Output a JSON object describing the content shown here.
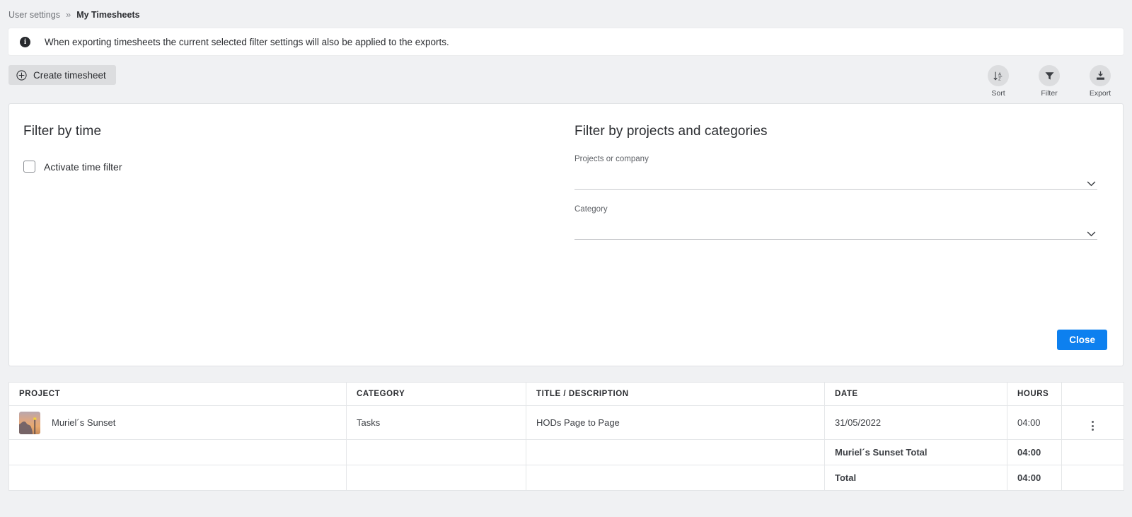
{
  "breadcrumb": {
    "parent": "User settings",
    "separator": "»",
    "current": "My Timesheets"
  },
  "banner": {
    "icon": "info-icon",
    "text": "When exporting timesheets the current selected filter settings will also be applied to the exports."
  },
  "actions": {
    "create_label": "Create timesheet",
    "create_icon": "plus-circle-icon",
    "tools": [
      {
        "label": "Sort",
        "icon": "sort-az-icon"
      },
      {
        "label": "Filter",
        "icon": "funnel-icon"
      },
      {
        "label": "Export",
        "icon": "download-tray-icon"
      }
    ]
  },
  "filter_panel": {
    "time": {
      "title": "Filter by time",
      "checkbox_label": "Activate time filter",
      "checkbox_checked": false
    },
    "projects": {
      "title": "Filter by projects and categories",
      "fields": [
        {
          "label": "Projects or company",
          "value": "",
          "icon": "chevron-down-icon"
        },
        {
          "label": "Category",
          "value": "",
          "icon": "chevron-down-icon"
        }
      ]
    },
    "close_label": "Close"
  },
  "table": {
    "columns": [
      "PROJECT",
      "CATEGORY",
      "TITLE / DESCRIPTION",
      "DATE",
      "HOURS",
      ""
    ],
    "rows": [
      {
        "project": "Muriel´s Sunset",
        "thumbnail": "sunset-photo",
        "category": "Tasks",
        "title": "HODs Page to Page",
        "date": "31/05/2022",
        "hours": "04:00",
        "menu_icon": "more-vertical-icon"
      }
    ],
    "subtotal": {
      "label": "Muriel´s Sunset Total",
      "hours": "04:00"
    },
    "total": {
      "label": "Total",
      "hours": "04:00"
    }
  },
  "colors": {
    "page_background": "#f0f1f3",
    "surface": "#ffffff",
    "accent_primary": "#0d80ef",
    "button_grey": "#dcdddf",
    "text_primary": "#2b2d31",
    "text_muted": "#6f7277",
    "border": "#e4e6e8"
  }
}
